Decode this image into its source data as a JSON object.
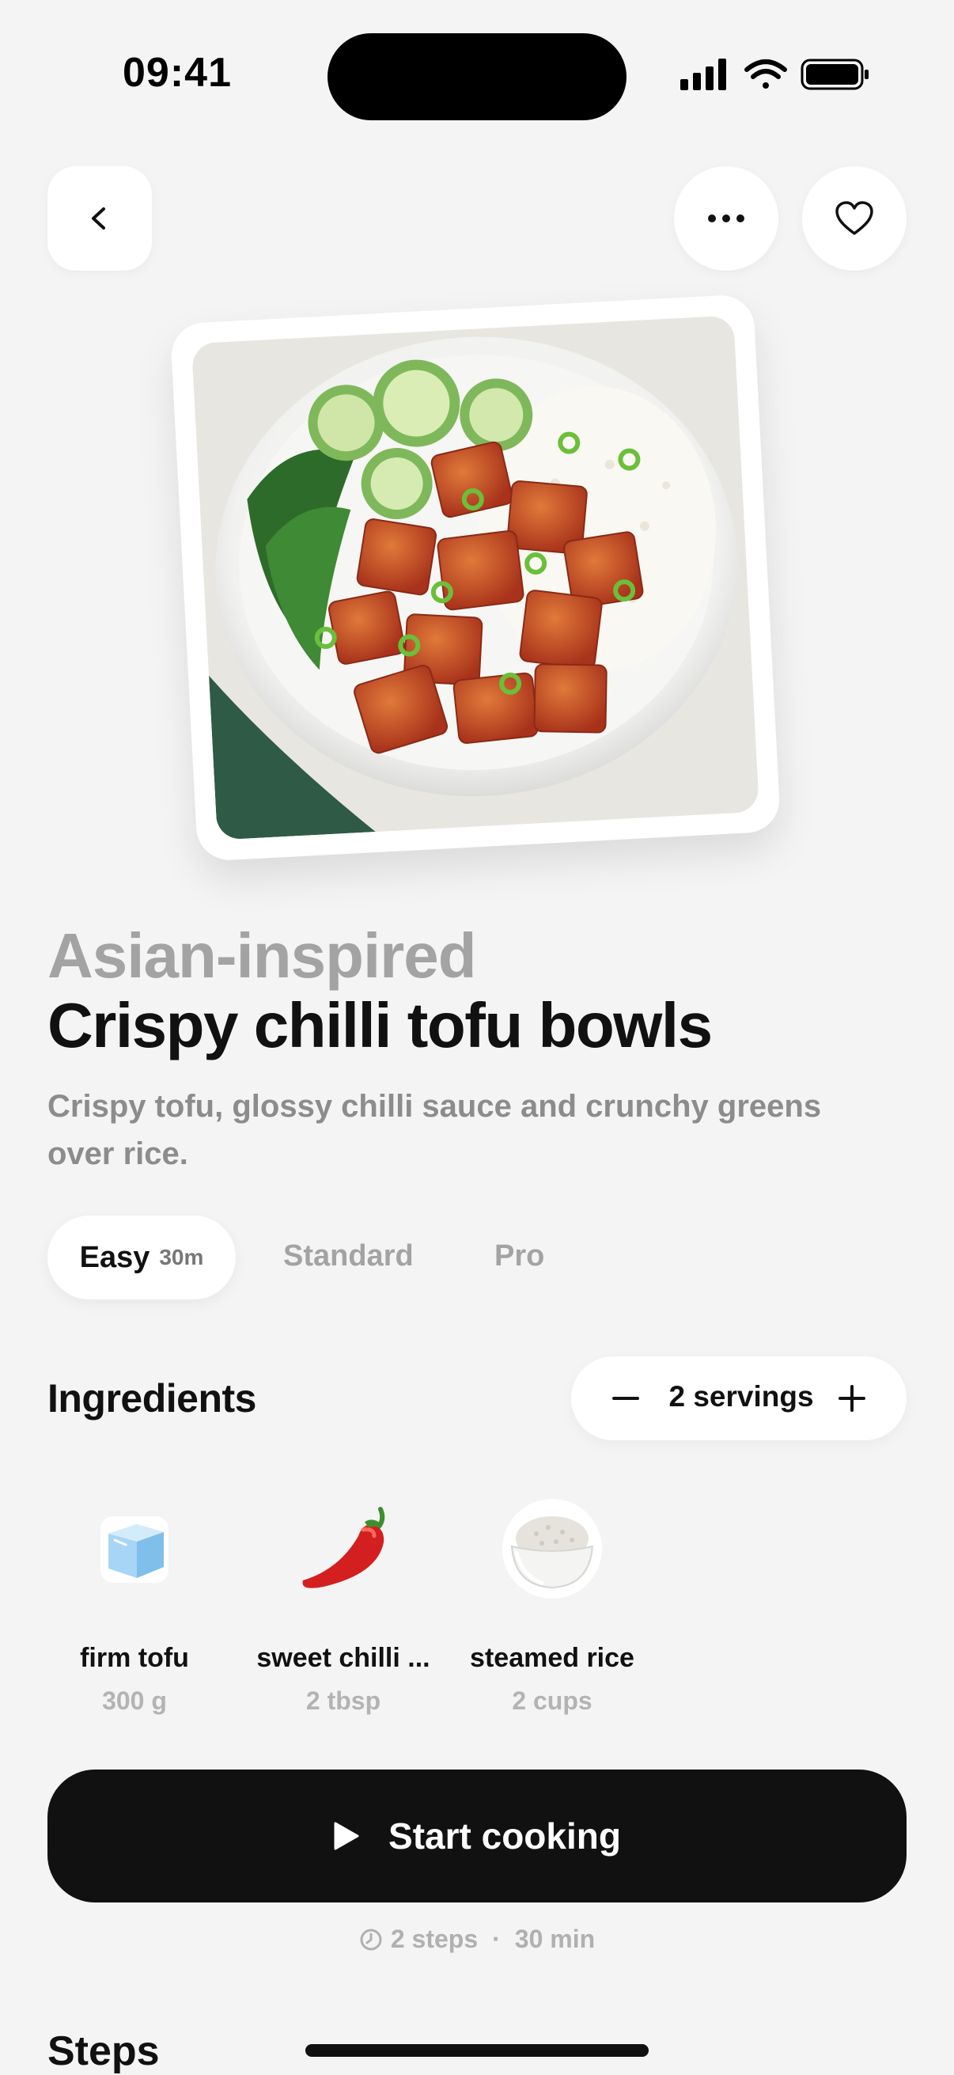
{
  "status_bar": {
    "time": "09:41"
  },
  "recipe": {
    "cuisine": "Asian-inspired",
    "title": "Crispy chilli tofu bowls",
    "description": "Crispy tofu, glossy chilli sauce and crunchy greens over rice."
  },
  "difficulty_tabs": [
    {
      "label": "Easy",
      "duration": "30m",
      "selected": true
    },
    {
      "label": "Standard",
      "selected": false
    },
    {
      "label": "Pro",
      "selected": false
    }
  ],
  "ingredients": {
    "heading": "Ingredients",
    "servings_label": "2 servings",
    "items": [
      {
        "name": "firm tofu",
        "quantity": "300 g",
        "icon": "ice-cube-icon"
      },
      {
        "name": "sweet chilli ...",
        "quantity": "2 tbsp",
        "icon": "chili-pepper-icon"
      },
      {
        "name": "steamed rice",
        "quantity": "2 cups",
        "icon": "rice-bowl-icon"
      }
    ]
  },
  "start_button": {
    "label": "Start cooking"
  },
  "meta": {
    "steps": "2 steps",
    "separator": "·",
    "time": "30 min"
  },
  "steps_heading": "Steps",
  "colors": {
    "background": "#f4f4f5",
    "primary_button": "#111111",
    "muted_text": "#a3a3a3"
  }
}
